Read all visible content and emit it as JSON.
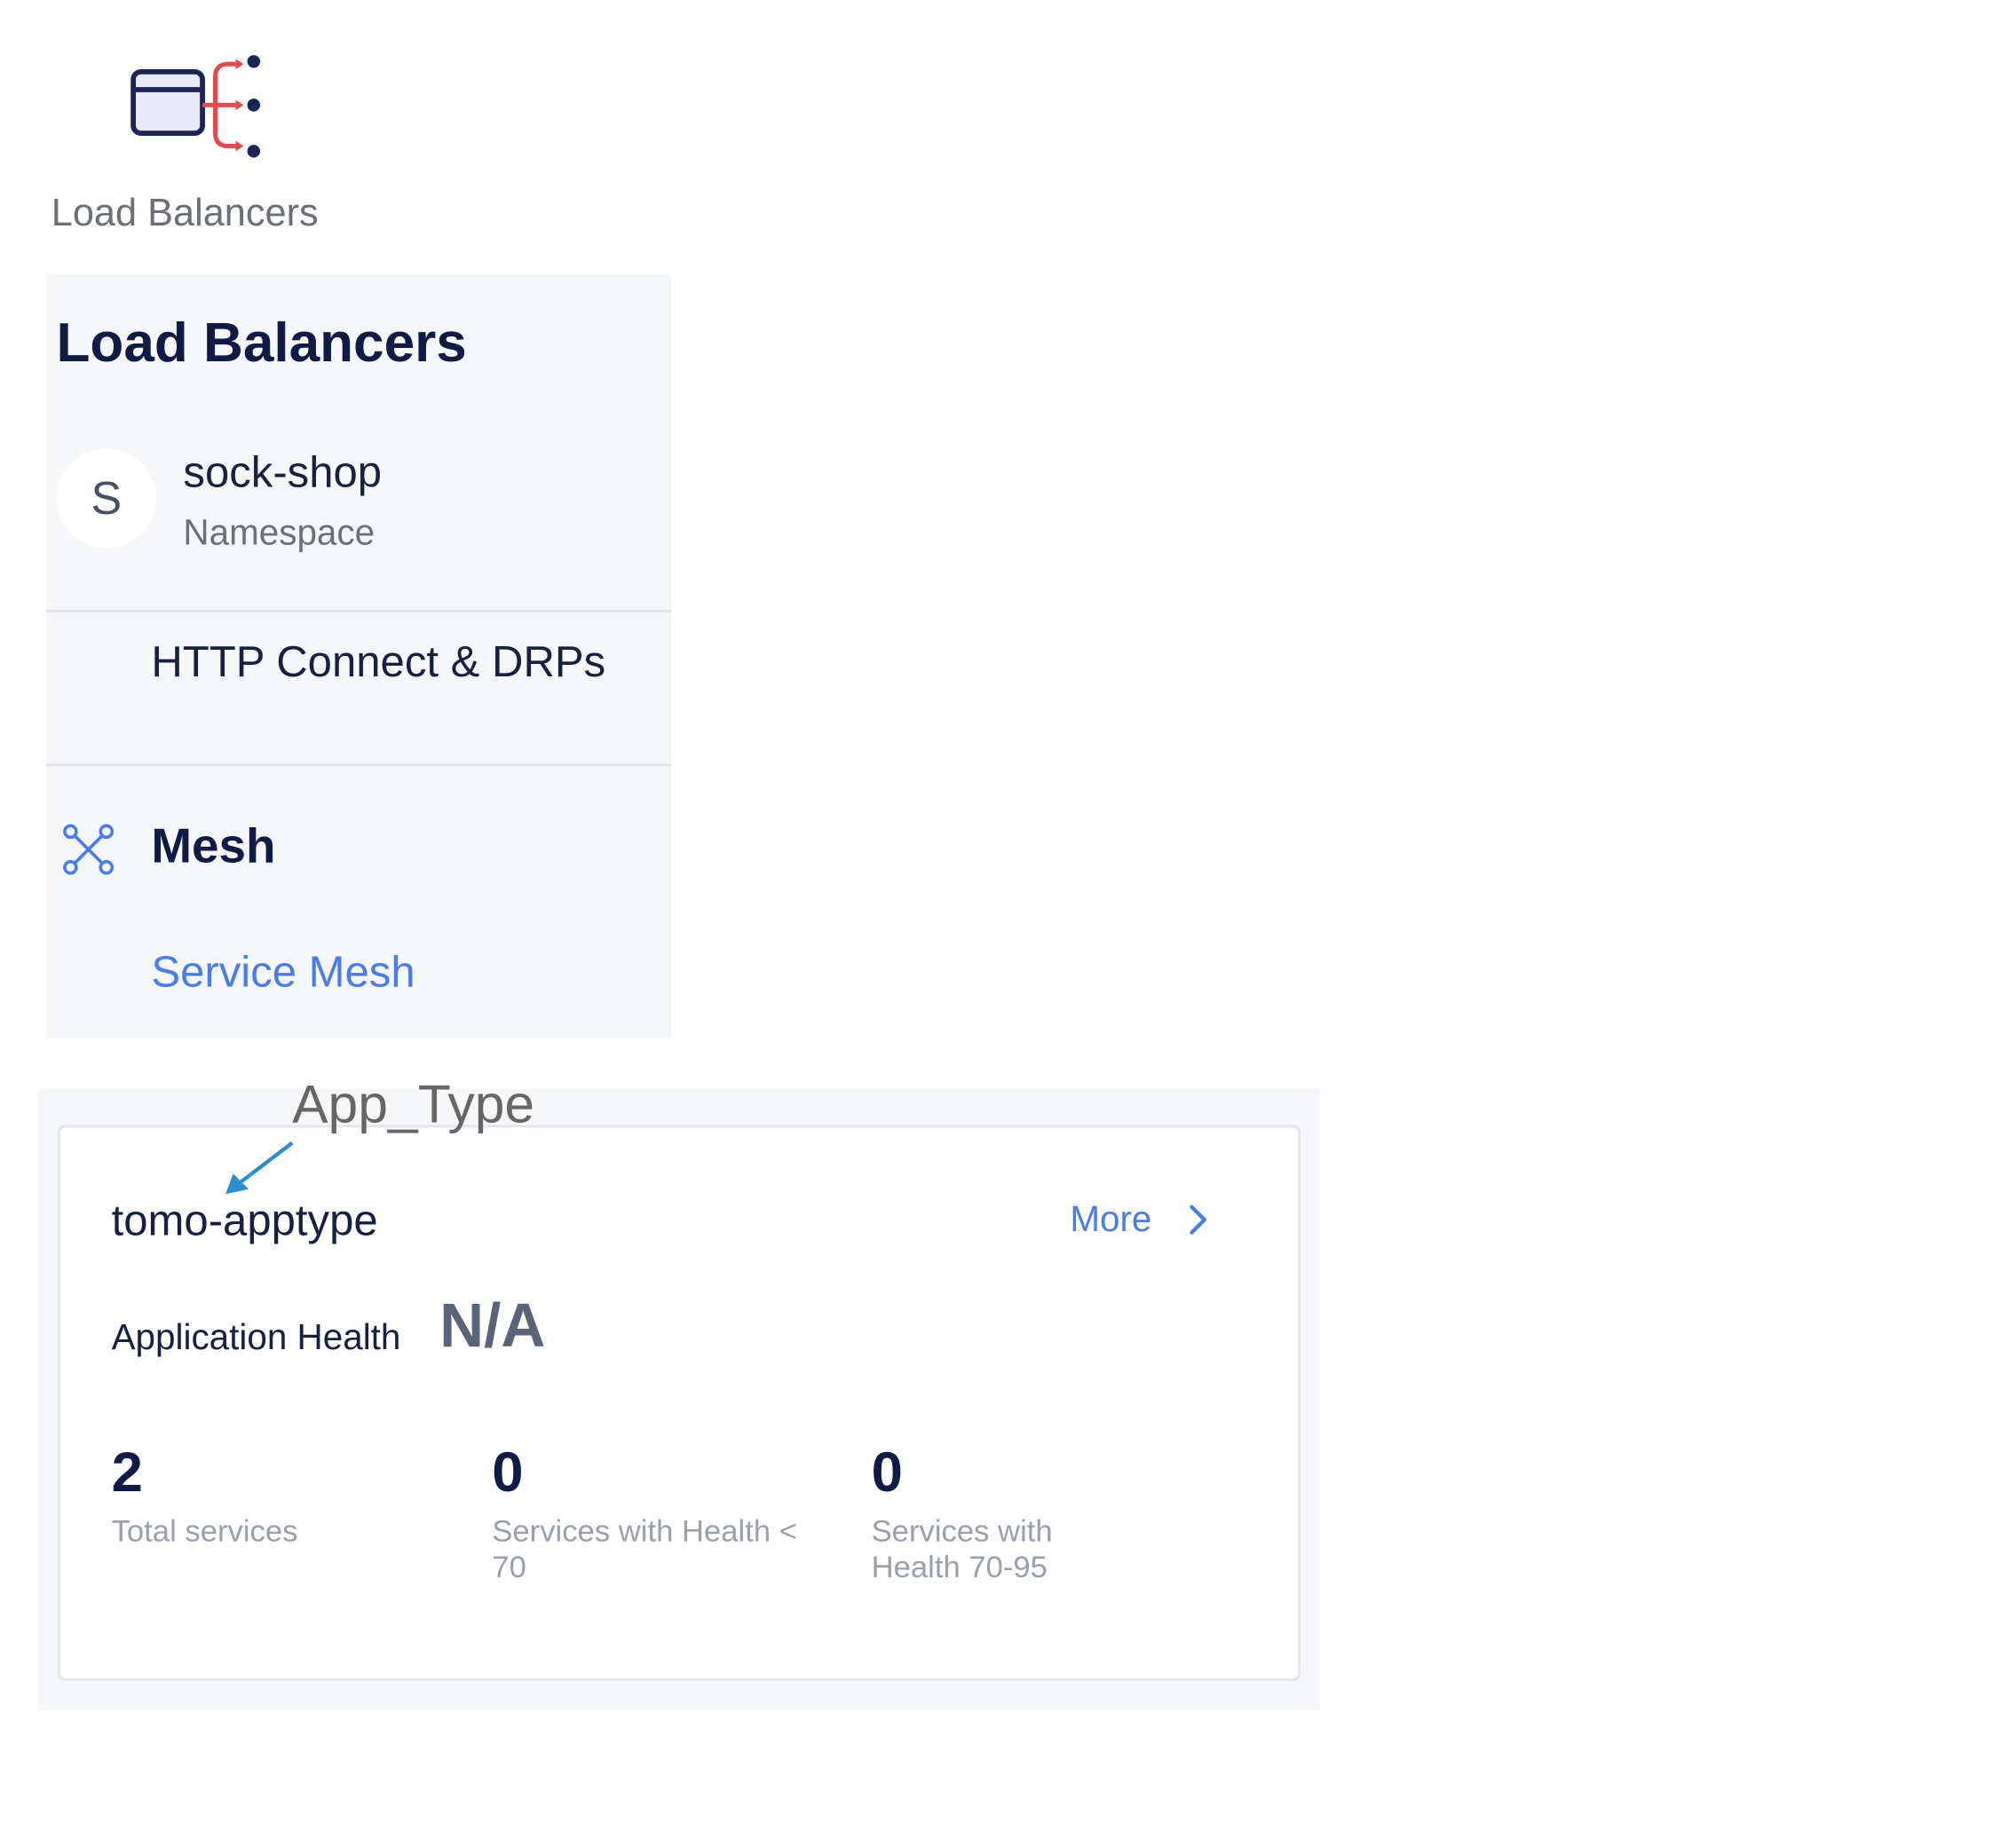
{
  "tile": {
    "icon": "load-balancer-icon",
    "caption": "Load Balancers"
  },
  "nav": {
    "title": "Load Balancers",
    "namespace": {
      "avatar_letter": "S",
      "name": "sock-shop",
      "label": "Namespace"
    },
    "http_item": "HTTP Connect & DRPs",
    "mesh": {
      "icon": "mesh-icon",
      "title": "Mesh",
      "link": "Service Mesh"
    }
  },
  "annotation": {
    "label": "App_Type",
    "arrow_color": "#2a8fd0"
  },
  "card": {
    "app_name": "tomo-apptype",
    "more_label": "More",
    "health_label": "Application Health",
    "health_value": "N/A",
    "stats": [
      {
        "value": "2",
        "label": "Total services"
      },
      {
        "value": "0",
        "label": "Services with Health < 70"
      },
      {
        "value": "0",
        "label": "Services with Health 70-95"
      }
    ]
  },
  "colors": {
    "navy": "#0f1b45",
    "link_blue": "#4a7cf0",
    "accent_red": "#e5484d",
    "panel_bg": "#f6f7f9"
  }
}
